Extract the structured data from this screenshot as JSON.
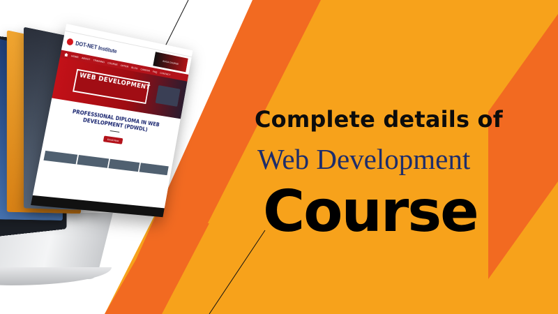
{
  "colors": {
    "orange": "#f7a21b",
    "orange_dark": "#f26a21",
    "navy": "#1e2d6b",
    "red": "#b3121a"
  },
  "headline": {
    "line1": "Complete details of",
    "line2": "Web Development",
    "line3": "Course"
  },
  "website": {
    "logo_text": "DOT-NET Institute",
    "ad_text": "AGGA COURSE",
    "nav_items": [
      "HOME",
      "ABOUT",
      "TRAINING",
      "COURSE",
      "OFFER",
      "BLOG",
      "CAREER",
      "FAQ",
      "CONTACT"
    ],
    "hero_title": "WEB DEVELOPMENT",
    "heading": "PROFESSIONAL DIPLOMA IN WEB DEVELOPMENT (PDWDL)",
    "button_label": "Enroll Now"
  }
}
